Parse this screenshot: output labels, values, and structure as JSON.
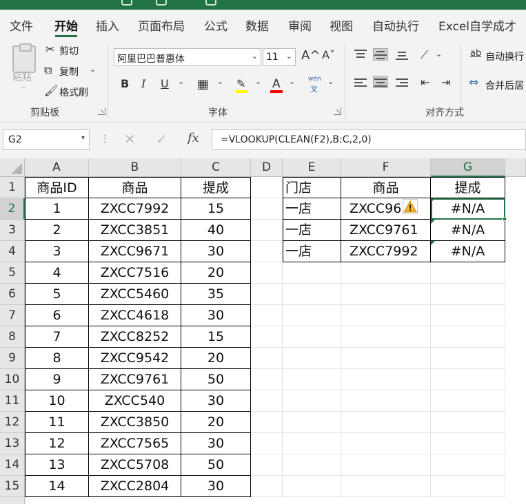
{
  "ribbon_tabs": [
    "文件",
    "开始",
    "插入",
    "页面布局",
    "公式",
    "数据",
    "审阅",
    "视图",
    "自动执行",
    "Excel自学成才"
  ],
  "active_tab": "开始",
  "clipboard": {
    "paste": "粘贴",
    "cut": "剪切",
    "copy": "复制",
    "format_painter": "格式刷",
    "group": "剪贴板"
  },
  "font": {
    "name": "阿里巴巴普惠体",
    "size": "11",
    "grow": "A^",
    "shrink": "A˅",
    "bold": "B",
    "italic": "I",
    "underline": "U",
    "phonetic_top": "wén",
    "phonetic_bottom": "文",
    "group": "字体",
    "highlight_color": "#ffff00",
    "font_color": "#ff0000"
  },
  "alignment": {
    "wrap_text": "自动换行",
    "merge_center": "合并后居",
    "group": "对齐方式",
    "wrap_glyph": "ab"
  },
  "formula_bar": {
    "name_box": "G2",
    "cancel": "✕",
    "enter": "✓",
    "fx": "fx",
    "formula": "=VLOOKUP(CLEAN(F2),B:C,2,0)"
  },
  "sheet": {
    "columns": [
      "A",
      "B",
      "C",
      "D",
      "E",
      "F",
      "G"
    ],
    "selected_column": "G",
    "rows": [
      "1",
      "2",
      "3",
      "4",
      "5",
      "6",
      "7",
      "8",
      "9",
      "10",
      "11",
      "12",
      "13",
      "14",
      "15"
    ],
    "selected_row": "2",
    "active_cell": "G2",
    "table1_header": [
      "商品ID",
      "商品",
      "提成"
    ],
    "table1": [
      [
        "1",
        "ZXCC7992",
        "15"
      ],
      [
        "2",
        "ZXCC3851",
        "40"
      ],
      [
        "3",
        "ZXCC9671",
        "30"
      ],
      [
        "4",
        "ZXCC7516",
        "20"
      ],
      [
        "5",
        "ZXCC5460",
        "35"
      ],
      [
        "6",
        "ZXCC4618",
        "30"
      ],
      [
        "7",
        "ZXCC8252",
        "15"
      ],
      [
        "8",
        "ZXCC9542",
        "20"
      ],
      [
        "9",
        "ZXCC9761",
        "50"
      ],
      [
        "10",
        "ZXCC540",
        "30"
      ],
      [
        "11",
        "ZXCC3850",
        "20"
      ],
      [
        "12",
        "ZXCC7565",
        "30"
      ],
      [
        "13",
        "ZXCC5708",
        "50"
      ],
      [
        "14",
        "ZXCC2804",
        "30"
      ]
    ],
    "table2_header": [
      "门店",
      "商品",
      "提成"
    ],
    "table2": [
      [
        "一店",
        "ZXCC96",
        "#N/A"
      ],
      [
        "一店",
        "ZXCC9761",
        "#N/A"
      ],
      [
        "一店",
        "ZXCC7992",
        "#N/A"
      ]
    ],
    "accent_color": "#217346",
    "warning_icon": "warning-icon"
  }
}
